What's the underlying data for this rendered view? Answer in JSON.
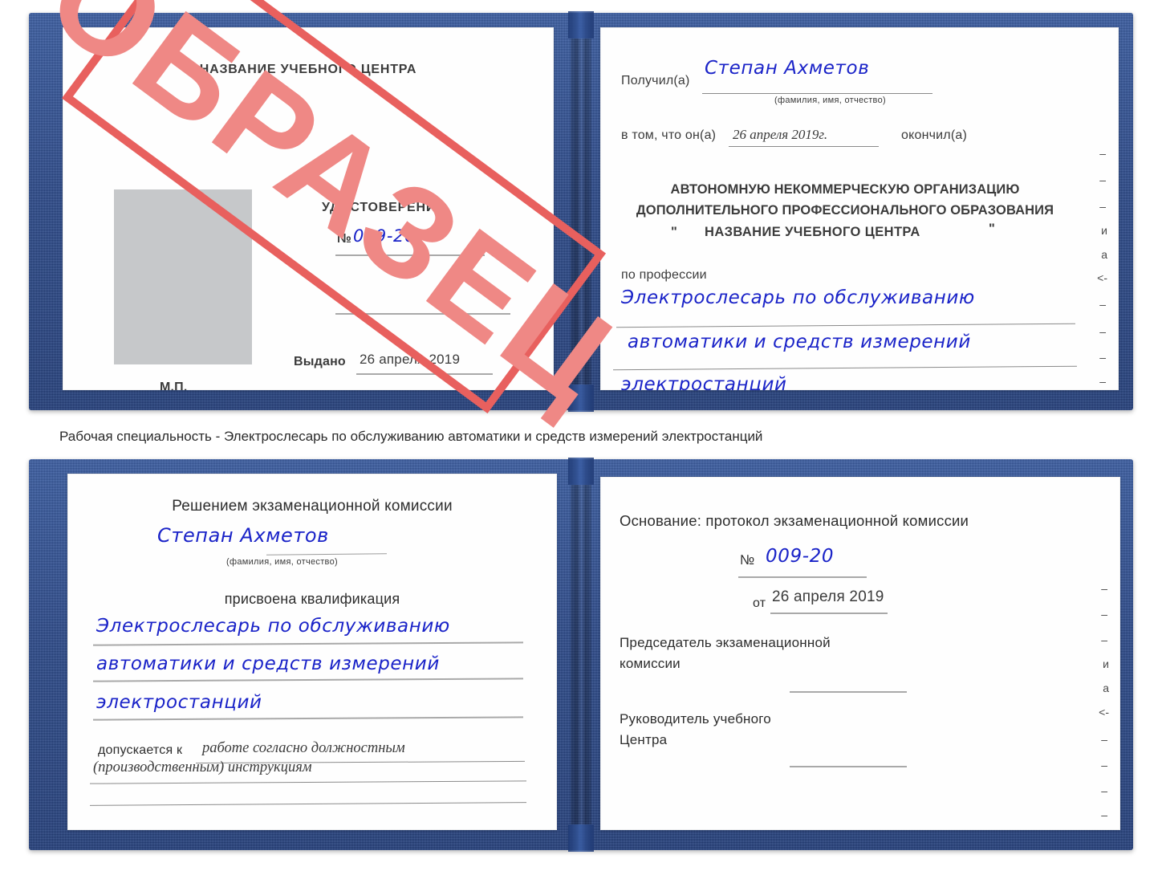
{
  "document": {
    "kind": "certificate-sample",
    "watermark": "ОБРАЗЕЦ",
    "caption": "Рабочая специальность - Электрослесарь по обслуживанию автоматики и средств измерений электростанций"
  },
  "colors": {
    "cover_blue": "#2e4f92",
    "stamp_red": "#e8605e",
    "stamp_fill": "#ef8885",
    "handwriting_blue": "#1a23c8",
    "paper": "#fefefe",
    "photo_placeholder": "#c6c8ca",
    "rule_grey": "#8a8a8a"
  },
  "top_certificate": {
    "left_page": {
      "org_title": "НАЗВАНИЕ УЧЕБНОГО ЦЕНТРА",
      "doc_type": "УДОСТОВЕРЕНИЕ",
      "number_label": "№",
      "number_value": "009-20",
      "issued_label": "Выдано",
      "issued_value": "26 апреля 2019",
      "seal_label": "М.П."
    },
    "right_page": {
      "received_label": "Получил(а)",
      "received_value": "Степан Ахметов",
      "name_hint": "(фамилия, имя, отчество)",
      "that_he_label": "в том, что он(а)",
      "completion_date": "26 апреля 2019г.",
      "finished_label": "окончил(а)",
      "institution_line1": "АВТОНОМНУЮ НЕКОММЕРЧЕСКУЮ ОРГАНИЗАЦИЮ",
      "institution_line2": "ДОПОЛНИТЕЛЬНОГО ПРОФЕССИОНАЛЬНОГО ОБРАЗОВАНИЯ",
      "institution_quote_open": "\"",
      "institution_name": "НАЗВАНИЕ УЧЕБНОГО ЦЕНТРА",
      "institution_quote_close": "\"",
      "profession_label": "по профессии",
      "profession_line1": "Электрослесарь по обслуживанию",
      "profession_line2": "автоматики и средств измерений",
      "profession_line3": "электростанций",
      "edge_bleed": [
        "–",
        "–",
        "–",
        "и",
        "а",
        "<-",
        "–",
        "–",
        "–",
        "–"
      ]
    }
  },
  "bottom_certificate": {
    "left_page": {
      "decision_title": "Решением экзаменационной комиссии",
      "holder_name": "Степан Ахметов",
      "name_hint": "(фамилия, имя, отчество)",
      "qualification_label": "присвоена квалификация",
      "qualification_line1": "Электрослесарь по обслуживанию",
      "qualification_line2": "автоматики и средств измерений",
      "qualification_line3": "электростанций",
      "admitted_label": "допускается к",
      "admitted_value_line1": "работе согласно должностным",
      "admitted_value_line2": "(производственным) инструкциям"
    },
    "right_page": {
      "basis_label": "Основание: протокол экзаменационной комиссии",
      "protocol_number_label": "№",
      "protocol_number_value": "009-20",
      "protocol_date_label": "от",
      "protocol_date_value": "26 апреля 2019",
      "chairman_line1": "Председатель экзаменационной",
      "chairman_line2": "комиссии",
      "head_line1": "Руководитель учебного",
      "head_line2": "Центра",
      "edge_bleed": [
        "–",
        "–",
        "–",
        "и",
        "а",
        "<-",
        "–",
        "–",
        "–",
        "–"
      ]
    }
  }
}
